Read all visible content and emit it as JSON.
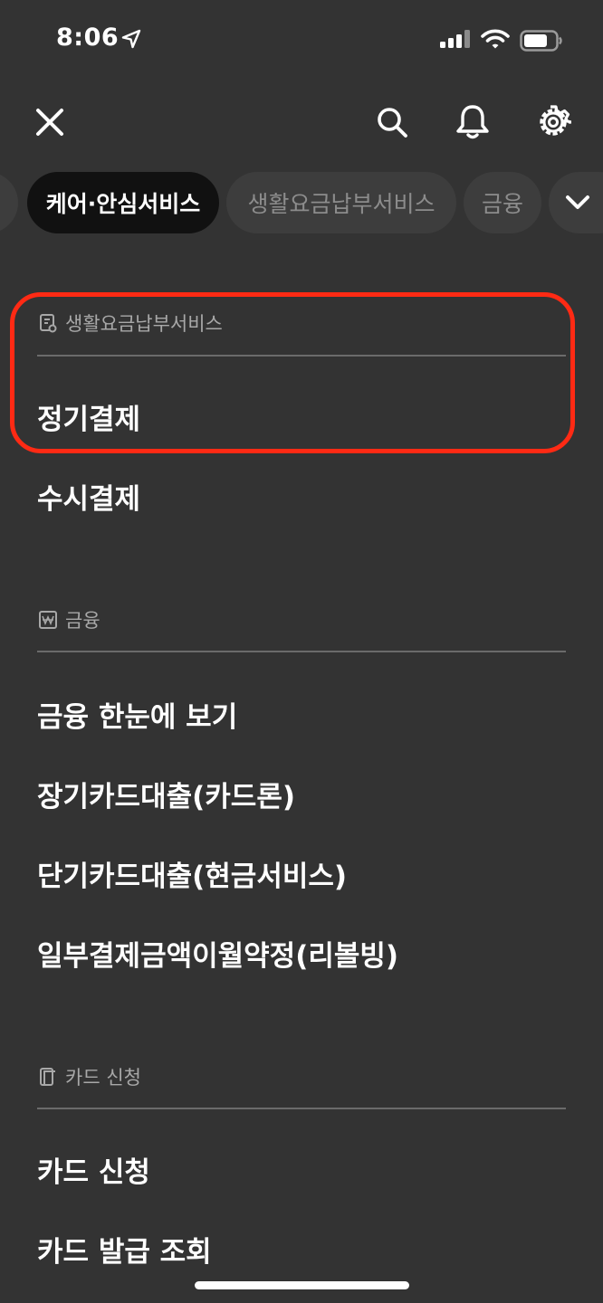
{
  "status_bar": {
    "time": "8:06"
  },
  "tabs": [
    {
      "label": "",
      "active": false
    },
    {
      "label": "케어·안심서비스",
      "active": true
    },
    {
      "label": "생활요금납부서비스",
      "active": false
    },
    {
      "label": "금융",
      "active": false
    },
    {
      "label": "",
      "active": false
    }
  ],
  "sections": [
    {
      "title": "생활요금납부서비스",
      "icon": "receipt-icon",
      "items": [
        "정기결제",
        "수시결제"
      ]
    },
    {
      "title": "금융",
      "icon": "won-icon",
      "items": [
        "금융 한눈에 보기",
        "장기카드대출(카드론)",
        "단기카드대출(현금서비스)",
        "일부결제금액이월약정(리볼빙)"
      ]
    },
    {
      "title": "카드 신청",
      "icon": "card-icon",
      "items": [
        "카드 신청",
        "카드 발급 조회"
      ]
    }
  ],
  "colors": {
    "background": "#333333",
    "highlight": "#ff2a14",
    "active_tab": "#111111"
  }
}
